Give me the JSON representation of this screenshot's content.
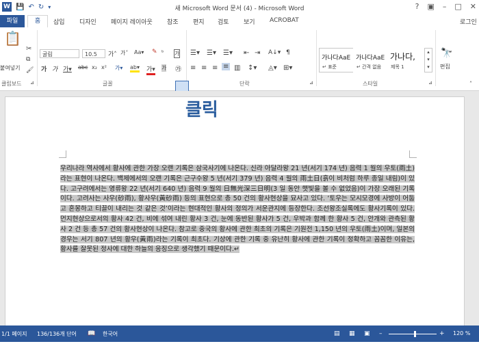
{
  "window": {
    "title": "새 Microsoft Word 문서 (4) - Microsoft Word",
    "controls": [
      "?",
      "▣",
      "–",
      "□",
      "✕"
    ]
  },
  "tabs": [
    "파일",
    "홈",
    "삽입",
    "디자인",
    "페이지 레이아웃",
    "참조",
    "편지",
    "검토",
    "보기",
    "ACROBAT"
  ],
  "signin": "로그인",
  "ribbon": {
    "clipboard": {
      "paste": "붙여넣기",
      "group": "클립보드"
    },
    "font": {
      "name": "굴림",
      "size": "10.5",
      "group": "글꼴"
    },
    "paragraph": {
      "group": "단락"
    },
    "styles": {
      "group": "스타일",
      "items": [
        {
          "sample": "가나다AaE",
          "name": "↵ 표준"
        },
        {
          "sample": "가나다AaE",
          "name": "↵ 간격 없음"
        },
        {
          "sample": "가나다,",
          "name": "제목 1"
        }
      ]
    },
    "editing": {
      "label": "편집"
    }
  },
  "callout": "클릭",
  "document": {
    "text": "우리나라 역사에서 황사에 관한 가장 오랜 기록은 삼국사기에 나온다. 신라 아달라왕 21 년(서기 174 년) 음력 1 월의 우토(雨土)라는 표현이 나온다. 백제에서의 오랜 기록은 근구수왕 5 년(서기 379 년) 음력 4 월의 雨土日(흙이 비처럼 하루 종일 내림)이 있다. 고구려에서는 영류왕 22 년(서기 640 년) 음력 9 월의 日無光深三日明(3 일 동안 햇빛을 볼 수 없었음)이 가장 오래된 기록이다. 고려사는 사우(砂雨), 황사우(黃砂雨) 등의 표현으로 총 50 건의 황사현상을 묘사고 있다. ‘토우는 모시모경에 사방이 어둡고 혼몽하고 티끌이 내리는 것 같은 것’이라는 현대적인 황사의 정의가 서운관지에 등장한다. 조선왕조실록에도 황사기록이 있다. 먼지현상으로서의 황사 42 건, 비에 섞여 내린 황사 3 건, 눈에 동반된 황사가 5 건, 우박과 함께 한 황사 5 건, 안개와 관측된 황사 2 건 등 총 57 건의 황사현상이 나온다. 참고로 중국의 황사에 관한 최초의 기록은 기원전 1,150 년의 우토(雨土)이며, 일본의 경우는 서기 807 년의 황우(黃雨)라는 기록이 최초다. 기상에 관한 기록 중 유난히 황사에 관한 기록이 정확하고 꼼꼼한 이유는, 황사를 잘못된 정사에 대한 하늘의 응징으로 생각했기 때문이다.↵"
  },
  "status": {
    "page": "1/1 페이지",
    "words": "136/136개 단어",
    "language": "한국어",
    "zoom": "120 %"
  }
}
